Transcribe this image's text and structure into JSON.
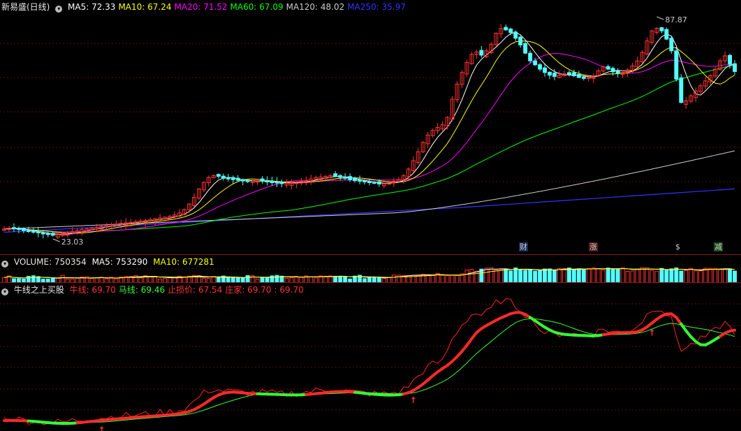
{
  "main": {
    "title": "新易盛(日线)",
    "ma": [
      {
        "label": "MA5: 72.33",
        "color": "#ffffff"
      },
      {
        "label": "MA10: 67.24",
        "color": "#ffff00"
      },
      {
        "label": "MA20: 71.52",
        "color": "#ff00ff"
      },
      {
        "label": "MA60: 67.09",
        "color": "#00ff00"
      },
      {
        "label": "MA120: 48.02",
        "color": "#cccccc"
      },
      {
        "label": "MA250: 35.97",
        "color": "#3333ff"
      }
    ],
    "high_label": "87.87",
    "low_label": "23.03",
    "badges": [
      {
        "text": "财",
        "color": "#5aa0ff"
      },
      {
        "text": "涨",
        "color": "#ff5555"
      },
      {
        "text": "$",
        "color": "#ff3333"
      },
      {
        "text": "减",
        "color": "#44dd44"
      }
    ]
  },
  "volume": {
    "label": "VOLUME: 750354",
    "ma5": "MA5: 753290",
    "ma10": "MA10: 677281"
  },
  "indicator": {
    "name": "牛线之上买股",
    "items": [
      {
        "label": "牛线: 69.70",
        "color": "#ff3333"
      },
      {
        "label": "马线: 69.46",
        "color": "#33ff33"
      },
      {
        "label": "止损价: 67.54",
        "color": "#ff3333"
      },
      {
        "label": "庄家: 69.70",
        "color": "#ff3333"
      },
      {
        "label": ": 69.70",
        "color": "#ff3333"
      }
    ]
  },
  "chart_data": {
    "type": "candlestick",
    "price_range": [
      23.03,
      87.87
    ],
    "close_approx": [
      25,
      25.2,
      25,
      24.8,
      24.5,
      24.2,
      24,
      23.8,
      23.5,
      23.3,
      23.1,
      23.3,
      23.5,
      23.8,
      24.2,
      24.5,
      24.8,
      25,
      25.2,
      25.5,
      25.8,
      26,
      26.2,
      26.5,
      26.7,
      26.9,
      27,
      27.2,
      27.4,
      27.6,
      27.8,
      28,
      28.3,
      28.5,
      28.8,
      29.2,
      29.8,
      30.8,
      32.5,
      34.5,
      37,
      39,
      40.5,
      41,
      40.8,
      40.2,
      40,
      39.8,
      39.6,
      39.4,
      39.2,
      39.3,
      39.5,
      39.3,
      39.1,
      38.9,
      38.8,
      38.6,
      38.7,
      38.9,
      39.1,
      39.3,
      39.6,
      40,
      40.4,
      40.6,
      40.8,
      41,
      40.8,
      40.5,
      40.2,
      39.8,
      39.5,
      39.3,
      39.1,
      38.9,
      38.7,
      38.5,
      38.6,
      38.9,
      39.3,
      39.8,
      41,
      43,
      45.5,
      48.2,
      51,
      53.2,
      54.6,
      55.5,
      56.3,
      58.5,
      64,
      68.5,
      72,
      75,
      77.5,
      78.2,
      77.2,
      78.5,
      80.5,
      83.8,
      85.2,
      84.8,
      84,
      82.3,
      80.3,
      77.8,
      75.5,
      74.3,
      73,
      72,
      71.2,
      70.8,
      71.2,
      71.6,
      71.4,
      71,
      70.5,
      70.2,
      70.5,
      71,
      72.5,
      73.7,
      73,
      72.2,
      71.8,
      72,
      72.8,
      74,
      75.5,
      78,
      81.5,
      84.5,
      85.3,
      84.5,
      82,
      78.5,
      70,
      63,
      63.5,
      65,
      66.5,
      68,
      69.5,
      71,
      73,
      75.5,
      77,
      74.5,
      72.3
    ],
    "volume_label": "VOLUME: 750354"
  }
}
